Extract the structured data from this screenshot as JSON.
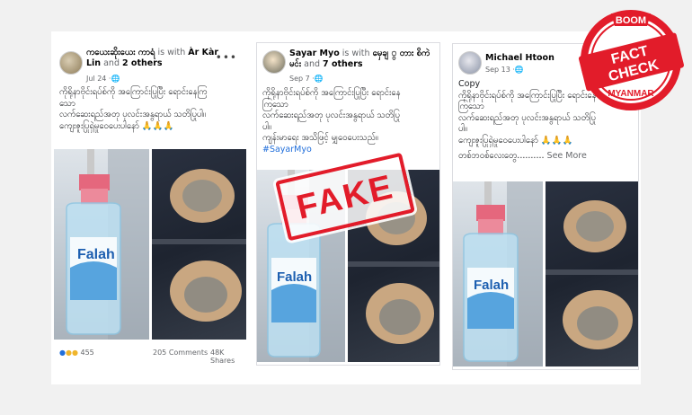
{
  "posts": [
    {
      "author": "ကယေးဆိုးယေး ကာရံ",
      "with_text": "is with",
      "with_name": "Àr Kàr",
      "others_line_name": "Lin",
      "others_line_and": "and",
      "others_count": "2 others",
      "date": "Jul 24",
      "body_lines": [
        "ကိုရိုနာဗိုင်းရပ်စ်ကို အကြောင်းပြုပြီး ရောင်းနေကြ",
        "သော",
        "လက်ဆေးရည်အတု ပုလင်းအနွရာယ် သတိပြုပါ။",
        "ကျေးဇူးပြုရှဲမှုဝေပေးပါနော် 🙏🙏🙏"
      ],
      "reactions_count": "455",
      "comments": "205 Comments",
      "shares": "48K Shares"
    },
    {
      "author": "Sayar Myo",
      "with_text": "is with",
      "with_name": "မှေချ ္ တား စိကဲ",
      "others_line_name": "မင်း",
      "others_line_and": "and",
      "others_count": "7 others",
      "date": "Sep 7",
      "body_lines": [
        "ကိုရိုနာဗိုင်းရပ်စ်ကို အကြောင်းပြုပြီး ရောင်းနေ",
        "ကြသော",
        "လက်ဆေးရည်အတု ပုလင်းအနွရာယ် သတိပြု",
        "ပါ။",
        "ကျန်းမာရေး အသိဖြင့် မျှဝေပေးသည်။"
      ],
      "hashtag": "#SayarMyo"
    },
    {
      "author": "Michael Htoon",
      "date": "Sep 13",
      "body_lines": [
        "Copy",
        "ကိုရိုနာဗိုင်းရပ်စ်ကို အကြောင်းပြုပြီး ရောင်းနေ",
        "ကြသော",
        "လက်ဆေးရည်အတု ပုလင်းအနွရာယ် သတိပြု",
        "ပါ။",
        "ကျေးဇူးပြုရှဲမှုဝေပေးပါနော် 🙏🙏🙏"
      ],
      "tail_text": "တစ်ဘဝစ်လေးတွေ..........",
      "see_more": "See More"
    }
  ],
  "bottle_brand": "Falah",
  "stamp_text": "FAKE",
  "badge": {
    "top": "BOOM",
    "line1": "FACT",
    "line2": "CHECK",
    "bottom": "MYANMAR"
  },
  "colors": {
    "accent_red": "#e21c2a",
    "link_blue": "#216fdb"
  },
  "icons": [
    "more-options-icon",
    "globe-icon",
    "like-reaction-icon",
    "sad-reaction-icon",
    "wow-reaction-icon"
  ]
}
